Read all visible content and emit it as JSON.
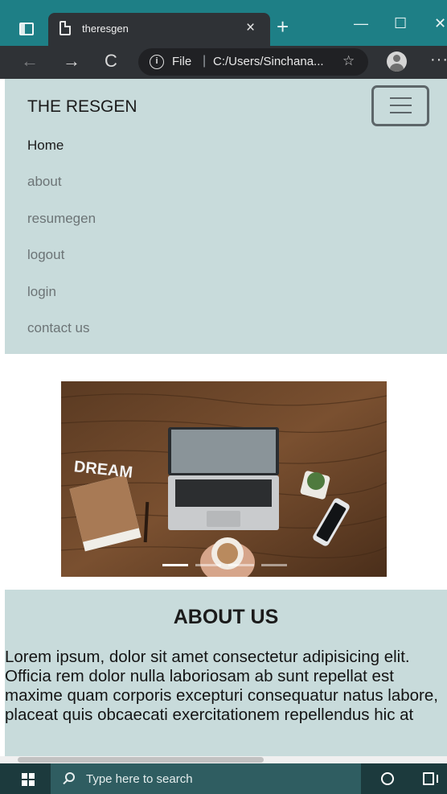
{
  "browser": {
    "tab_title": "theresgen",
    "tab_close": "×",
    "new_tab": "+",
    "minimize": "—",
    "maximize": "☐",
    "close": "✕",
    "back": "←",
    "forward": "→",
    "reload": "C",
    "info_glyph": "i",
    "file_label": "File",
    "separator": "|",
    "url": "C:/Users/Sinchana...",
    "favorites_glyph": "☆",
    "more": "···"
  },
  "navbar": {
    "brand": "THE RESGEN",
    "links": [
      {
        "label": "Home",
        "active": true
      },
      {
        "label": "about",
        "active": false
      },
      {
        "label": "resumegen",
        "active": false
      },
      {
        "label": "logout",
        "active": false
      },
      {
        "label": "login",
        "active": false
      },
      {
        "label": "contact us",
        "active": false
      }
    ]
  },
  "carousel": {
    "dream_text": "DREAM",
    "slide_count": 4,
    "active_slide": 1
  },
  "about": {
    "heading": "ABOUT US",
    "text": "Lorem ipsum, dolor sit amet consectetur adipisicing elit. Officia rem dolor nulla laboriosam ab sunt repellat est maxime quam corporis excepturi consequatur natus labore, placeat quis obcaecati exercitationem repellendus hic at"
  },
  "taskbar": {
    "search_placeholder": "Type here to search"
  },
  "colors": {
    "titlebar": "#1e7f86",
    "toolbar": "#2f3236",
    "navbar_bg": "#c8dbdb",
    "taskbar": "#1c3a3d",
    "taskbar_search": "#2f5d61"
  }
}
